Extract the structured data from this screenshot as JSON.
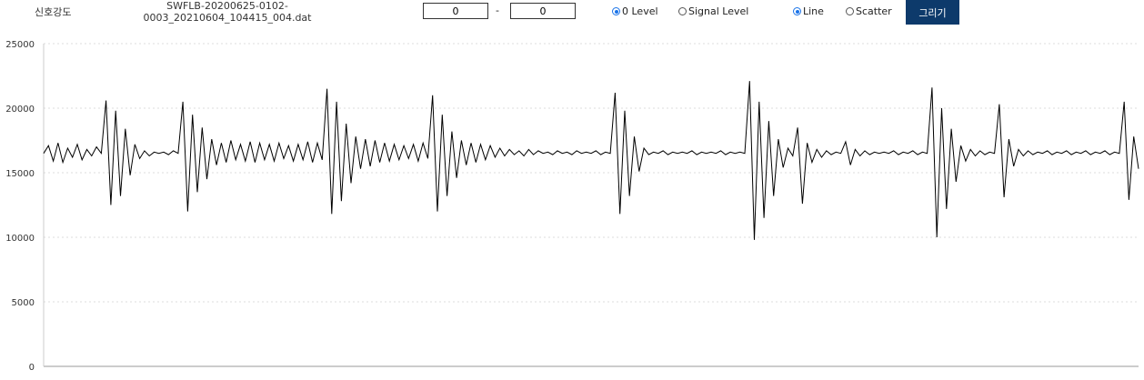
{
  "toolbar": {
    "title": "신호강도",
    "filename_line1": "SWFLB-20200625-0102-",
    "filename_line2": "0003_20210604_104415_004.dat",
    "range_start": "0",
    "range_separator": "-",
    "range_end": "0",
    "radio_zero_level": "0 Level",
    "radio_signal_level": "Signal Level",
    "radio_line": "Line",
    "radio_scatter": "Scatter",
    "draw_button": "그리기",
    "selected_level": "0 Level",
    "selected_mode": "Line",
    "accent_color": "#1a73e8",
    "button_color": "#0d3a6b"
  },
  "chart_data": {
    "type": "line",
    "title": "",
    "xlabel": "",
    "ylabel": "",
    "ylim": [
      0,
      25000
    ],
    "yticks": [
      "25000",
      "20000",
      "15000",
      "10000",
      "5000",
      "0"
    ],
    "grid": "horizontal dotted",
    "line_color": "#000000",
    "baseline": 16500,
    "series": [
      {
        "values": [
          16500,
          17100,
          15900,
          17300,
          15800,
          16900,
          16200,
          17200,
          16000,
          16800,
          16300,
          17000,
          16500,
          20600,
          12500,
          19800,
          13200,
          18400,
          14800,
          17200,
          16100,
          16700,
          16300,
          16600,
          16500,
          16600,
          16400,
          16700,
          16500,
          20500,
          12000,
          19500,
          13500,
          18500,
          14500,
          17600,
          15600,
          17300,
          15800,
          17500,
          16000,
          17200,
          15900,
          17400,
          15800,
          17300,
          16000,
          17200,
          15900,
          17300,
          16100,
          17100,
          15900,
          17200,
          16000,
          17400,
          15800,
          17300,
          16000,
          21500,
          11800,
          20500,
          12800,
          18800,
          14200,
          17800,
          15300,
          17600,
          15500,
          17500,
          15800,
          17300,
          15900,
          17200,
          16000,
          17100,
          16100,
          17200,
          15900,
          17300,
          16100,
          21000,
          12000,
          19500,
          13200,
          18200,
          14600,
          17500,
          15600,
          17300,
          15800,
          17200,
          16000,
          17100,
          16200,
          16900,
          16300,
          16800,
          16400,
          16700,
          16300,
          16800,
          16400,
          16700,
          16500,
          16600,
          16400,
          16700,
          16500,
          16600,
          16400,
          16700,
          16500,
          16600,
          16500,
          16700,
          16400,
          16600,
          16500,
          21200,
          11800,
          19800,
          13200,
          17800,
          15100,
          16900,
          16400,
          16600,
          16500,
          16700,
          16400,
          16600,
          16500,
          16600,
          16500,
          16700,
          16400,
          16600,
          16500,
          16600,
          16500,
          16700,
          16400,
          16600,
          16500,
          16600,
          16500,
          22100,
          9800,
          20500,
          11500,
          19000,
          13200,
          17600,
          15400,
          16900,
          16300,
          18500,
          12600,
          17300,
          15800,
          16800,
          16200,
          16700,
          16400,
          16600,
          16500,
          17400,
          15600,
          16800,
          16300,
          16700,
          16400,
          16600,
          16500,
          16600,
          16500,
          16700,
          16400,
          16600,
          16500,
          16700,
          16400,
          16600,
          16500,
          21600,
          10000,
          20000,
          12200,
          18400,
          14300,
          17100,
          15900,
          16800,
          16300,
          16700,
          16400,
          16600,
          16500,
          20300,
          13100,
          17600,
          15500,
          16800,
          16300,
          16700,
          16400,
          16600,
          16500,
          16700,
          16400,
          16600,
          16500,
          16700,
          16400,
          16600,
          16500,
          16700,
          16400,
          16600,
          16500,
          16700,
          16400,
          16600,
          16500,
          20500,
          12900,
          17800,
          15300
        ]
      }
    ]
  }
}
